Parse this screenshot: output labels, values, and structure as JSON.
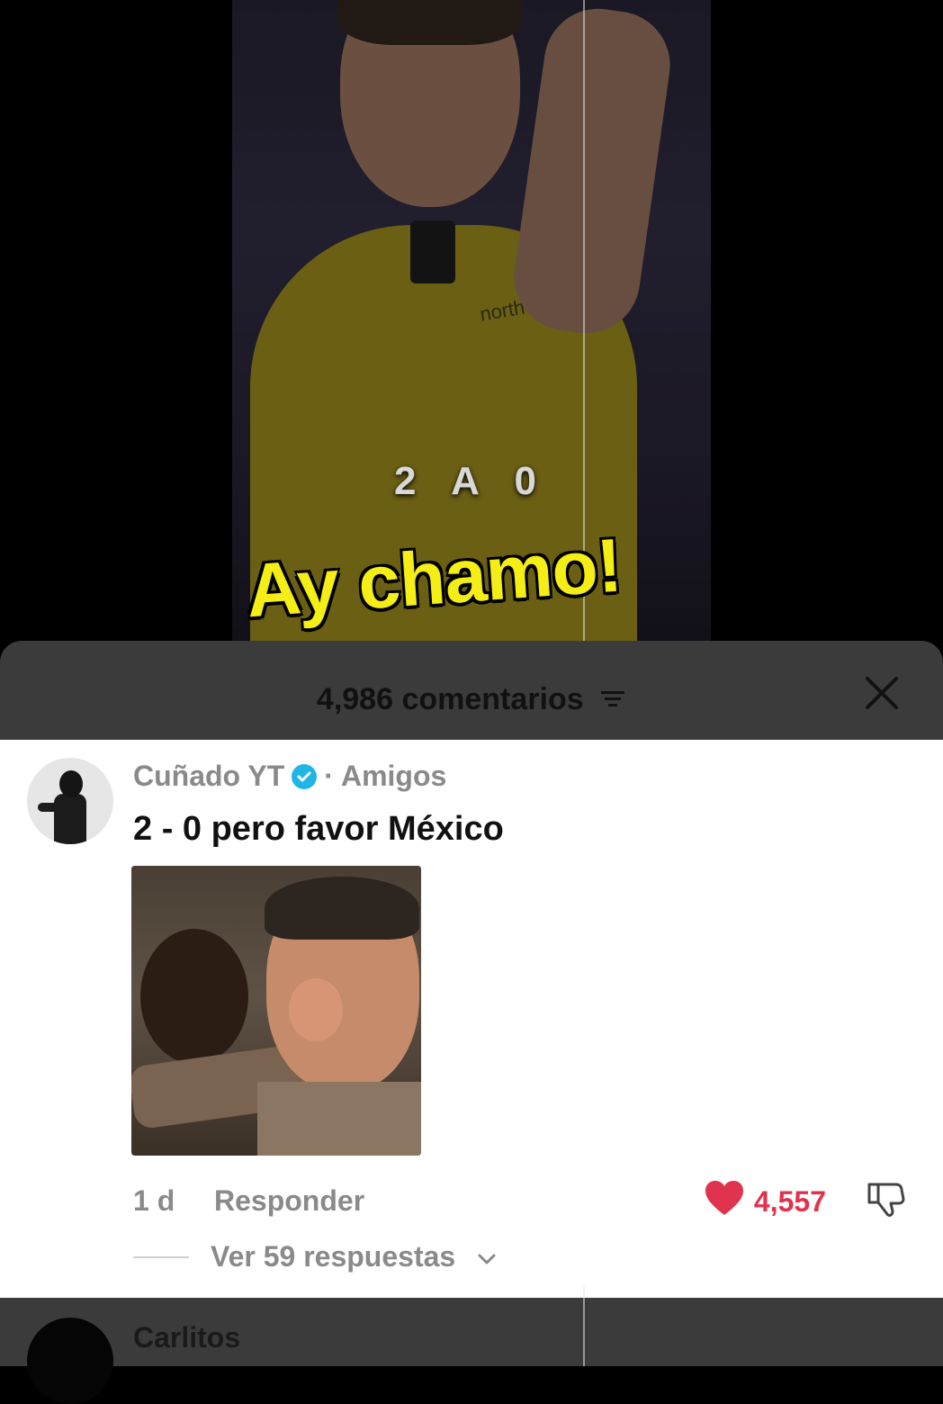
{
  "video": {
    "shirt_brand": "northom",
    "overlay_score": "2 A 0",
    "caption": "Ay chamo!"
  },
  "comments_sheet": {
    "count_label": "4,986 comentarios",
    "filter_icon": "filter-icon",
    "close_icon": "close-icon"
  },
  "comment": {
    "username": "Cuñado YT",
    "verified": true,
    "separator": "·",
    "relation": "Amigos",
    "text": "2 - 0 pero favor México",
    "time": "1 d",
    "reply_label": "Responder",
    "like_count": "4,557",
    "replies_label": "Ver 59 respuestas"
  },
  "next_comment": {
    "username": "Carlitos"
  },
  "colors": {
    "caption_yellow": "#f5ee16",
    "like_red": "#e0344e",
    "verified_blue": "#1fb6e6"
  }
}
